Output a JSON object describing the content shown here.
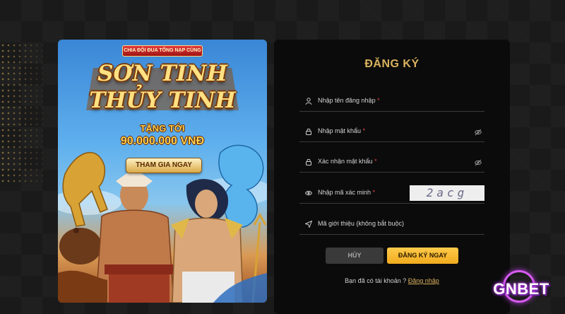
{
  "banner": {
    "tag": "CHIA ĐỘI ĐUA TỔNG NẠP CÙNG",
    "title_line1": "SƠN TINH",
    "title_line2": "THỦY TINH",
    "gift_label": "TẶNG TỚI",
    "amount": "90.000.000 VNĐ",
    "cta": "THAM GIA NGAY"
  },
  "form": {
    "title": "ĐĂNG KÝ",
    "fields": [
      {
        "label": "Nhập tên đăng nhập",
        "required": "*",
        "icon": "user-icon"
      },
      {
        "label": "Nhập mật khẩu",
        "required": "*",
        "icon": "lock-icon",
        "toggle_icon": "eye-off-icon"
      },
      {
        "label": "Xác nhận mật khẩu",
        "required": "*",
        "icon": "lock-icon",
        "toggle_icon": "eye-off-icon"
      },
      {
        "label": "Nhập mã xác minh",
        "required": "*",
        "icon": "shield-eye-icon"
      },
      {
        "label": "Mã giới thiệu (không bắt buộc)",
        "icon": "send-icon"
      }
    ],
    "captcha": "2acg",
    "cancel_label": "HỦY",
    "submit_label": "ĐĂNG KÝ NGAY",
    "footer_text": "Bạn đã có tài khoản ?",
    "footer_link": "Đăng nhập"
  },
  "logo": {
    "text": "GNBET"
  },
  "colors": {
    "accent_gold": "#d9b15e",
    "button_yellow": "#f5b82a",
    "required_red": "#e04848",
    "logo_glow": "#c040e0"
  }
}
